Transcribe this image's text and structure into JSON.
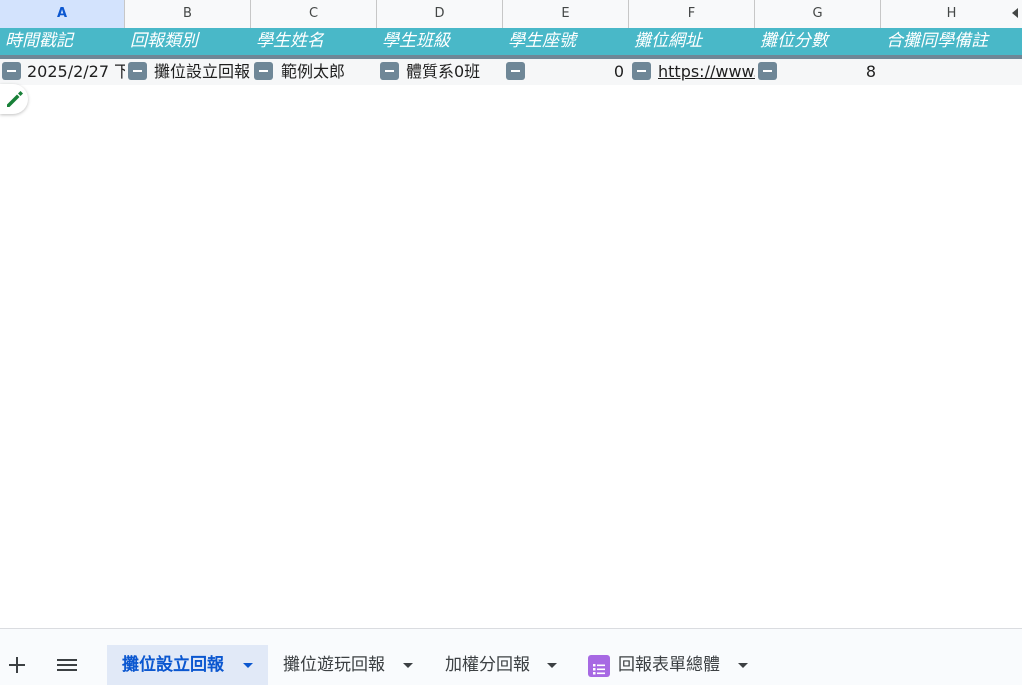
{
  "columns": [
    "A",
    "B",
    "C",
    "D",
    "E",
    "F",
    "G",
    "H"
  ],
  "selected_column": "A",
  "headers": [
    "時間戳記",
    "回報類別",
    "學生姓名",
    "學生班級",
    "學生座號",
    "攤位網址",
    "攤位分數",
    "合攤同學備註"
  ],
  "row1": {
    "timestamp": "2025/2/27 下",
    "category": "攤位設立回報",
    "name": "範例太郎",
    "class": "體質系0班",
    "seat": "0",
    "url": "https://www.p",
    "score": "8",
    "note": ""
  },
  "sheet_tabs": [
    {
      "label": "攤位設立回報",
      "active": true
    },
    {
      "label": "攤位遊玩回報",
      "active": false
    },
    {
      "label": "加權分回報",
      "active": false
    },
    {
      "label": "回報表單總體",
      "active": false,
      "icon": "form-icon"
    }
  ],
  "colors": {
    "header_teal": "#49b8c8",
    "active_tab": "#0b57d0",
    "form_icon": "#a769e3"
  },
  "icons": [
    "minus-chip-icon",
    "edit-pencil-icon",
    "plus-icon",
    "menu-icon",
    "dropdown-caret-icon",
    "scroll-left-icon"
  ]
}
